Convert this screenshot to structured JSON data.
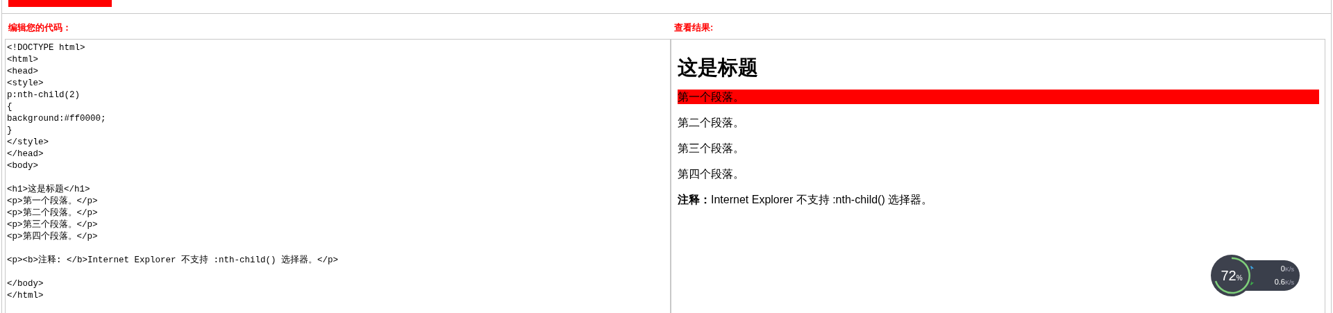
{
  "editor": {
    "label": "编辑您的代码：",
    "code": "<!DOCTYPE html>\n<html>\n<head>\n<style>\np:nth-child(2)\n{\nbackground:#ff0000;\n}\n</style>\n</head>\n<body>\n\n<h1>这是标题</h1>\n<p>第一个段落。</p>\n<p>第二个段落。</p>\n<p>第三个段落。</p>\n<p>第四个段落。</p>\n\n<p><b>注释: </b>Internet Explorer 不支持 :nth-child() 选择器。</p>\n\n</body>\n</html>"
  },
  "result": {
    "label": "查看结果:",
    "heading": "这是标题",
    "paragraphs": [
      {
        "text": "第一个段落。",
        "highlighted": true
      },
      {
        "text": "第二个段落。",
        "highlighted": false
      },
      {
        "text": "第三个段落。",
        "highlighted": false
      },
      {
        "text": "第四个段落。",
        "highlighted": false
      },
      {
        "text": "**注释：**Internet Explorer 不支持 :nth-child() 选择器。",
        "highlighted": false
      }
    ]
  },
  "speed_widget": {
    "percent": "72",
    "percent_sign": "%",
    "upload": {
      "value": "0",
      "unit": "K/s"
    },
    "download": {
      "value": "0.6",
      "unit": "K/s"
    }
  }
}
